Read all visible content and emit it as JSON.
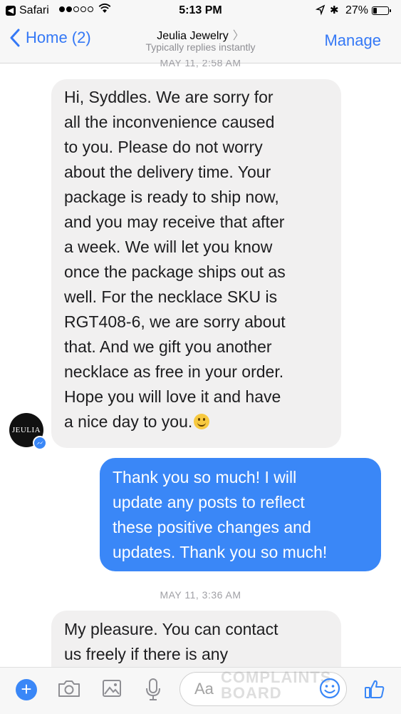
{
  "status_bar": {
    "app": "Safari",
    "time": "5:13 PM",
    "battery": "27%",
    "battery_level": 0.27
  },
  "nav": {
    "back_label": "Home (2)",
    "title": "Jeulia Jewelry",
    "subtitle": "Typically replies instantly",
    "action_label": "Manage"
  },
  "chat": {
    "timestamp_1": "MAY 11, 2:58 AM",
    "message_1": "Hi, Syddles. We are sorry for\nall the inconvenience caused\nto you. Please do not worry\nabout the delivery time. Your\npackage is ready to ship now,\nand you may receive that after\na week.  We will let you know\nonce the package ships out as\nwell.   For the necklace SKU is\nRGT408-6, we are sorry about\nthat. And we gift you another\nnecklace as free in your order.\nHope you will love it and have\na nice day to you.",
    "message_2": "Thank you so much! I will\nupdate any posts to reflect\nthese positive changes and\nupdates. Thank you so much!",
    "timestamp_2": "MAY 11, 3:36 AM",
    "message_3": "My pleasure. You can contact\nus freely if there is any",
    "avatar_text": "JEULIA"
  },
  "composer": {
    "placeholder": "Aa",
    "watermark": "COMPLAINTS\nBOARD"
  },
  "colors": {
    "accent": "#3478f6",
    "outgoing_bubble": "#3a87f7",
    "incoming_bubble": "#f1f0f0"
  }
}
